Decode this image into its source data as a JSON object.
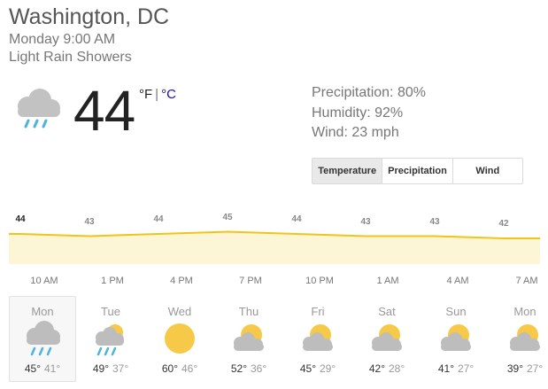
{
  "location": "Washington, DC",
  "datetime": "Monday 9:00 AM",
  "condition": "Light Rain Showers",
  "current": {
    "temp": "44",
    "unit_f": "°F",
    "unit_sep": "|",
    "unit_c": "°C",
    "icon": "rain-cloud-icon"
  },
  "stats": {
    "precipitation": "Precipitation: 80%",
    "humidity": "Humidity: 92%",
    "wind": "Wind: 23 mph"
  },
  "tabs": [
    {
      "label": "Temperature",
      "active": true
    },
    {
      "label": "Precipitation",
      "active": false
    },
    {
      "label": "Wind",
      "active": false
    }
  ],
  "chart_data": {
    "type": "area",
    "series": [
      {
        "values": [
          44,
          43,
          44,
          45,
          44,
          43,
          43,
          42
        ]
      }
    ],
    "value_labels": [
      "44",
      "43",
      "44",
      "45",
      "44",
      "43",
      "43",
      "42"
    ],
    "time_labels": [
      "10 AM",
      "1 PM",
      "4 PM",
      "7 PM",
      "10 PM",
      "1 AM",
      "4 AM",
      "7 AM"
    ],
    "colors": {
      "line": "#f0c419",
      "fill": "#fdf6d6"
    }
  },
  "forecast": [
    {
      "day": "Mon",
      "high": "45°",
      "low": "41°",
      "icon": "rain-cloud-icon",
      "selected": true
    },
    {
      "day": "Tue",
      "high": "49°",
      "low": "37°",
      "icon": "sun-rain-cloud-icon"
    },
    {
      "day": "Wed",
      "high": "60°",
      "low": "46°",
      "icon": "sun-icon"
    },
    {
      "day": "Thu",
      "high": "52°",
      "low": "36°",
      "icon": "partly-cloudy-icon"
    },
    {
      "day": "Fri",
      "high": "45°",
      "low": "29°",
      "icon": "partly-cloudy-icon"
    },
    {
      "day": "Sat",
      "high": "42°",
      "low": "28°",
      "icon": "partly-cloudy-icon"
    },
    {
      "day": "Sun",
      "high": "41°",
      "low": "27°",
      "icon": "partly-cloudy-icon"
    },
    {
      "day": "Mon",
      "high": "39°",
      "low": "27°",
      "icon": "partly-cloudy-icon"
    }
  ]
}
